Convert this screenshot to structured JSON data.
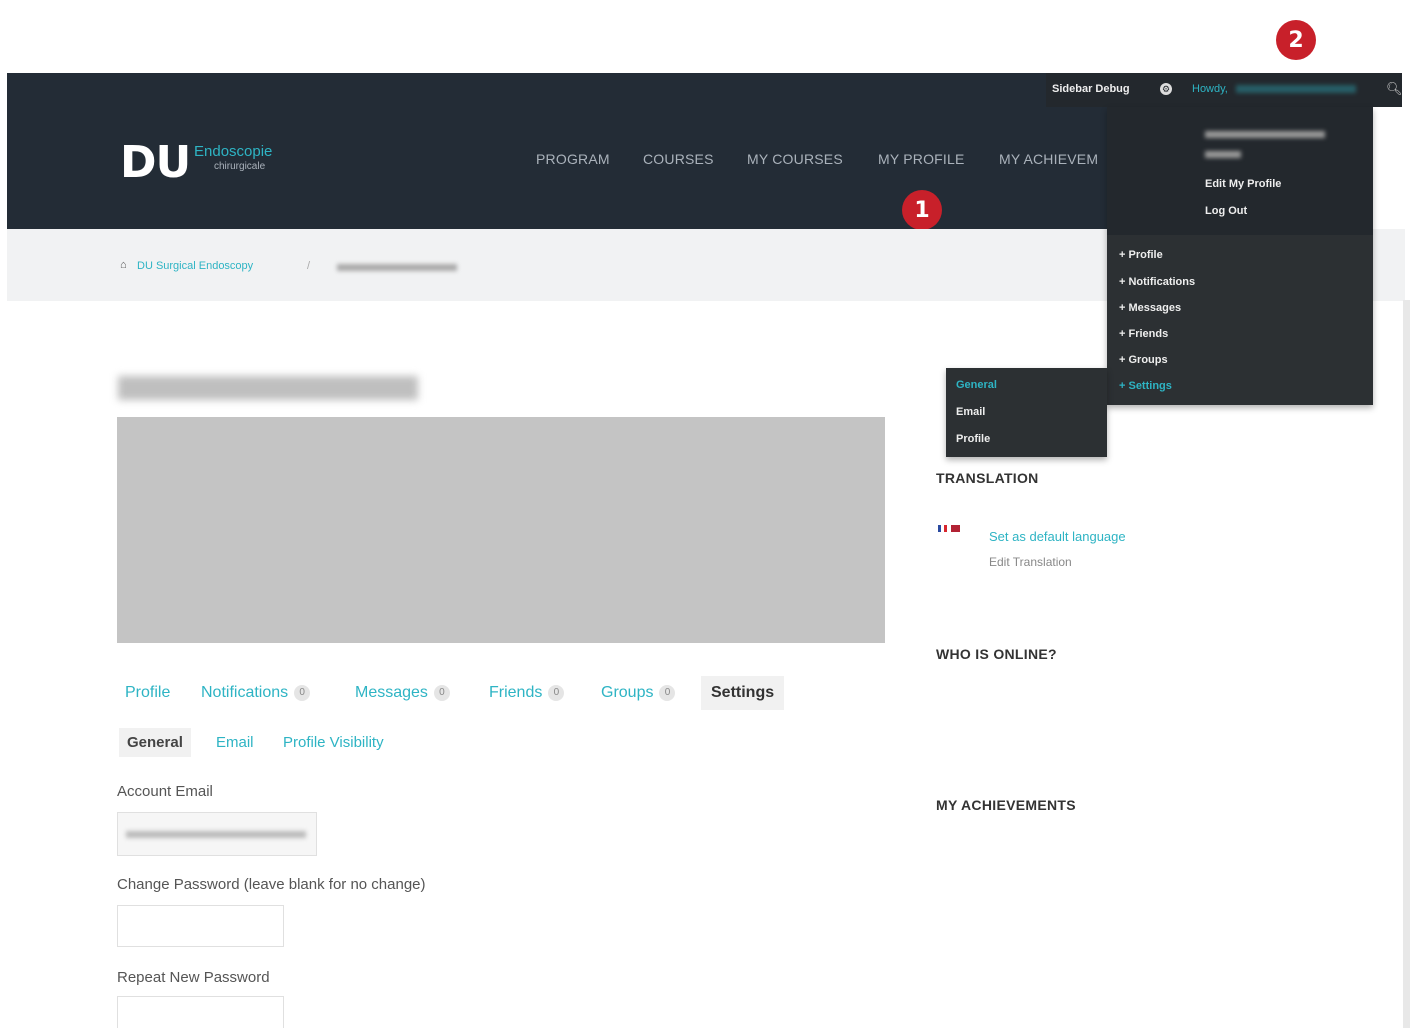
{
  "annotations": {
    "badge1": "1",
    "badge2": "2"
  },
  "admin_bar": {
    "sidebar_debug": "Sidebar Debug",
    "howdy": "Howdy,",
    "search_icon": "magnifier-icon"
  },
  "header": {
    "logo_du": "DU",
    "logo_endoscopie": "Endoscopie",
    "logo_chirurgicale": "chirurgicale",
    "nav": [
      "PROGRAM",
      "COURSES",
      "MY COURSES",
      "MY PROFILE",
      "MY ACHIEVEM"
    ]
  },
  "breadcrumb": {
    "home_icon": "home-icon",
    "link": "DU Surgical Endoscopy",
    "separator": "/"
  },
  "user_dropdown": {
    "edit_profile": "Edit My Profile",
    "logout": "Log Out",
    "items": [
      "+ Profile",
      "+ Notifications",
      "+ Messages",
      "+ Friends",
      "+ Groups",
      "+ Settings"
    ]
  },
  "settings_submenu": {
    "items": [
      "General",
      "Email",
      "Profile"
    ]
  },
  "profile_tabs": {
    "profile": "Profile",
    "notifications": "Notifications",
    "notifications_count": "0",
    "messages": "Messages",
    "messages_count": "0",
    "friends": "Friends",
    "friends_count": "0",
    "groups": "Groups",
    "groups_count": "0",
    "settings": "Settings"
  },
  "settings_tabs": {
    "general": "General",
    "email": "Email",
    "profile_visibility": "Profile Visibility"
  },
  "form": {
    "account_email_label": "Account Email",
    "change_password_label": "Change Password (leave blank for no change)",
    "repeat_password_label": "Repeat New Password"
  },
  "sidebar": {
    "translation_title": "TRANSLATION",
    "set_default_language": "Set as default language",
    "edit_translation": "Edit Translation",
    "who_is_online_title": "WHO IS ONLINE?",
    "my_achievements_title": "MY ACHIEVEMENTS"
  },
  "colors": {
    "header_bg": "#232c36",
    "accent": "#2eb4c4",
    "badge": "#c8202a"
  }
}
